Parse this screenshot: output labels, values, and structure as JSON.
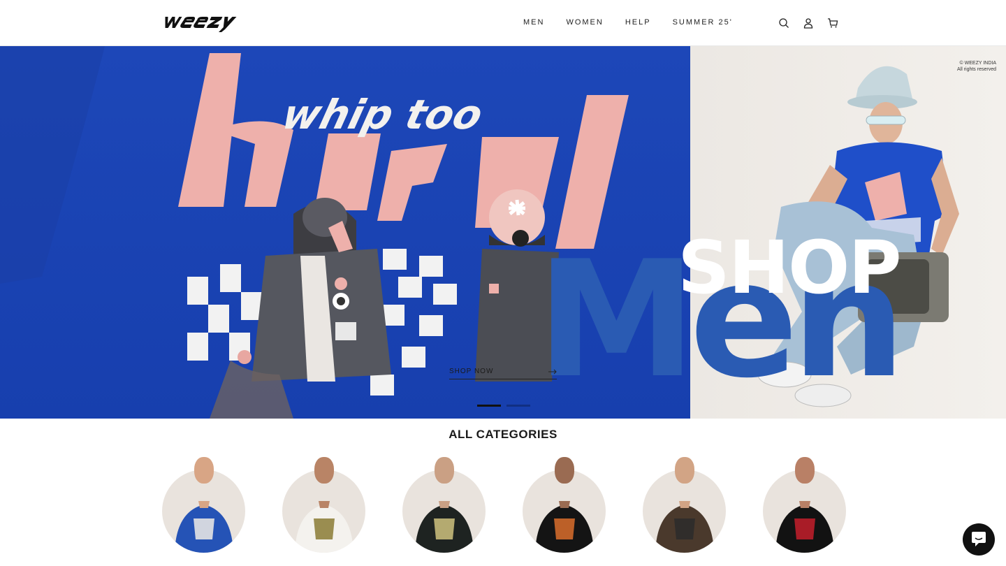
{
  "brand": {
    "logo_text": "weezy"
  },
  "nav": {
    "items": [
      {
        "label": "MEN"
      },
      {
        "label": "WOMEN"
      },
      {
        "label": "HELP"
      },
      {
        "label": "SUMMER 25'"
      }
    ]
  },
  "header_icons": [
    "search-icon",
    "account-icon",
    "cart-icon"
  ],
  "hero": {
    "copyright_line1": "© WEEZY INDIA",
    "copyright_line2": "All rights reserved",
    "headline_top": "SHOP",
    "headline_bottom": "Men",
    "cta_label": "SHOP NOW",
    "slide_count": 2,
    "active_slide": 1,
    "colors": {
      "blue": "#1d47b8",
      "accent": "#2a5bb3",
      "pink": "#eeb0ab"
    }
  },
  "categories": {
    "title": "ALL CATEGORIES",
    "items": [
      {
        "shirt": "#2553b6",
        "trim": "#f0ece6",
        "skin": "#d8a585"
      },
      {
        "shirt": "#f4f2ee",
        "trim": "#8a7b34",
        "skin": "#b98466"
      },
      {
        "shirt": "#1e2321",
        "trim": "#cfc27e",
        "skin": "#caa084"
      },
      {
        "shirt": "#141414",
        "trim": "#d96d2b",
        "skin": "#9a6b52"
      },
      {
        "shirt": "#4a392c",
        "trim": "#2b2b2b",
        "skin": "#d2a485"
      },
      {
        "shirt": "#121212",
        "trim": "#c41f2c",
        "skin": "#b98066"
      }
    ]
  },
  "chat": {
    "icon": "chat-icon"
  }
}
